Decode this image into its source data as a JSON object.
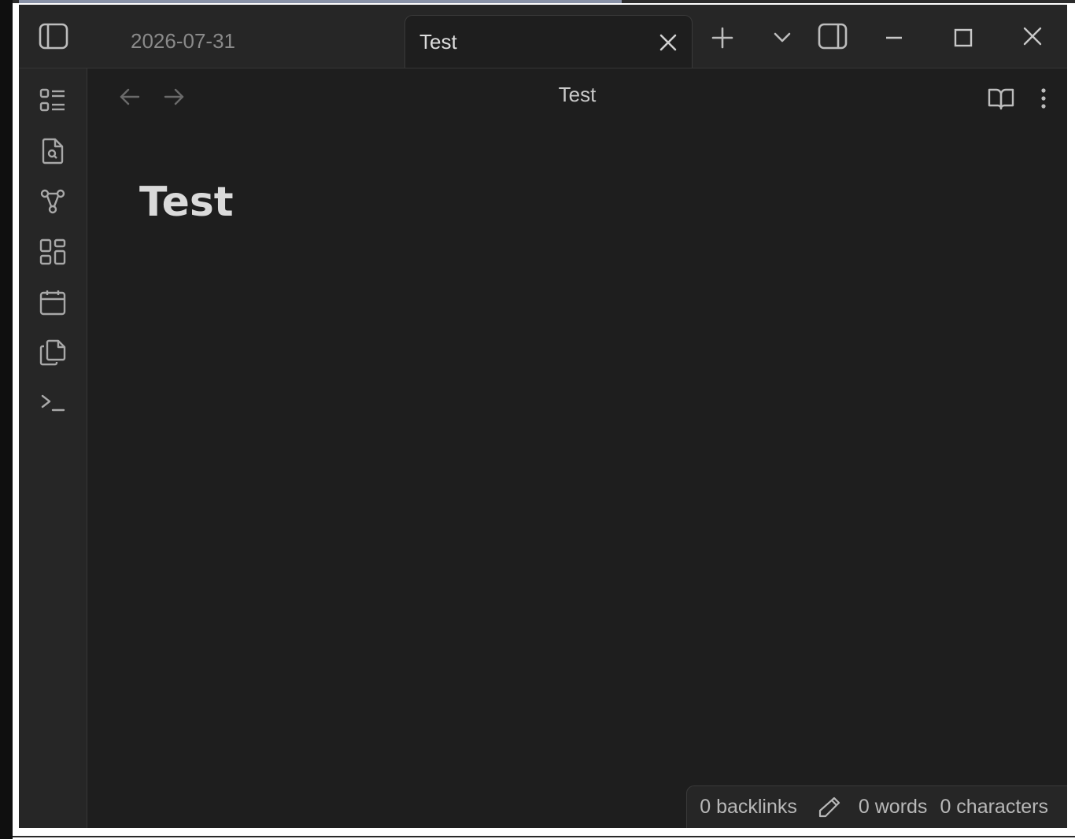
{
  "tabs": [
    {
      "label": "2026-07-31",
      "active": false
    },
    {
      "label": "Test",
      "active": true
    }
  ],
  "view": {
    "title": "Test",
    "note_title": "Test"
  },
  "ribbon": {
    "items": [
      "outline-icon",
      "file-search-icon",
      "graph-icon",
      "dashboard-icon",
      "calendar-icon",
      "copy-files-icon",
      "terminal-icon"
    ]
  },
  "status": {
    "backlinks": "0 backlinks",
    "words": "0 words",
    "characters": "0 characters"
  },
  "colors": {
    "background": "#1e1e1e",
    "chrome": "#262626",
    "text": "#dadada",
    "muted": "#8a8a8a"
  }
}
